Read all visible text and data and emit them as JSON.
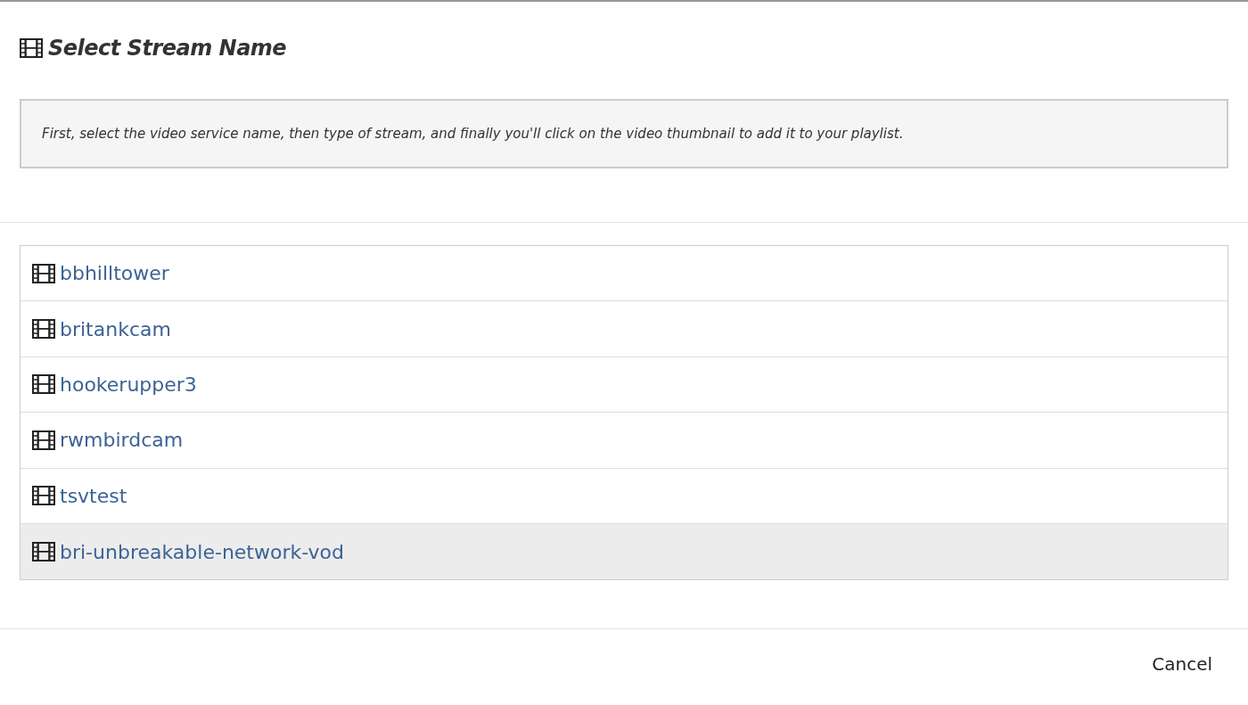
{
  "title": "Select Stream Name",
  "instructions": "First, select the video service name, then type of stream, and finally you'll click on the video thumbnail to add it to your playlist.",
  "streams": [
    {
      "name": "bbhilltower",
      "selected": false
    },
    {
      "name": "britankcam",
      "selected": false
    },
    {
      "name": "hookerupper3",
      "selected": false
    },
    {
      "name": "rwmbirdcam",
      "selected": false
    },
    {
      "name": "tsvtest",
      "selected": false
    },
    {
      "name": "bri-unbreakable-network-vod",
      "selected": true
    }
  ],
  "buttons": [
    "Cancel"
  ]
}
